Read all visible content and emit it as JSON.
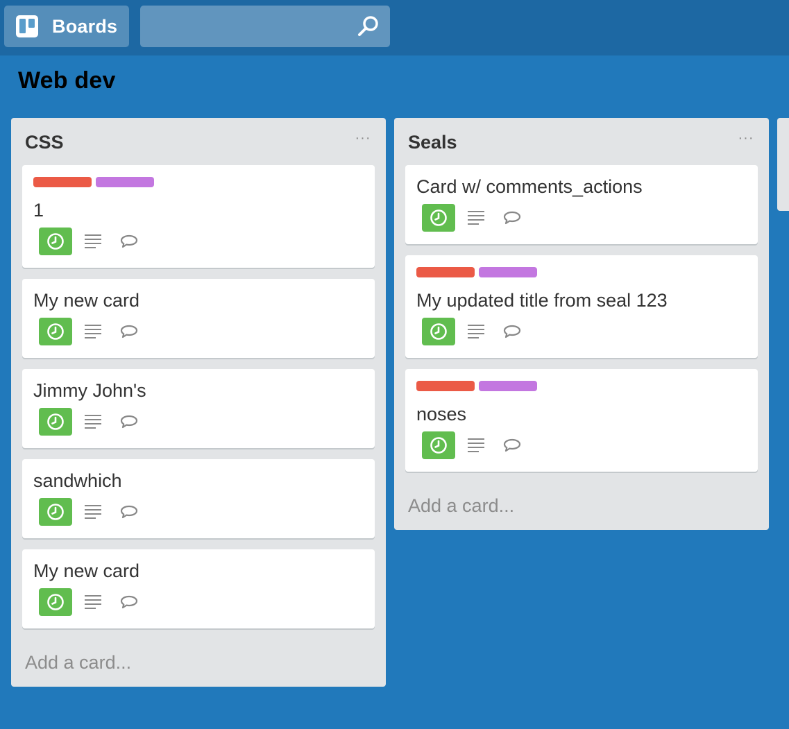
{
  "header": {
    "boards_label": "Boards",
    "boards_icon": "boards-icon",
    "search_icon": "search-icon",
    "search_value": ""
  },
  "board": {
    "title": "Web dev"
  },
  "lists": [
    {
      "name": "CSS",
      "menu_glyph": "···",
      "add_card": "Add a card...",
      "cards": [
        {
          "title": "1",
          "labels": [
            "#eb5a46",
            "#c377e0"
          ]
        },
        {
          "title": "My new card",
          "labels": []
        },
        {
          "title": "Jimmy John's",
          "labels": []
        },
        {
          "title": "sandwhich",
          "labels": []
        },
        {
          "title": "My new card",
          "labels": []
        }
      ]
    },
    {
      "name": "Seals",
      "menu_glyph": "···",
      "add_card": "Add a card...",
      "cards": [
        {
          "title": "Card w/ comments_actions",
          "labels": []
        },
        {
          "title": "My updated title from seal 123",
          "labels": [
            "#eb5a46",
            "#c377e0"
          ]
        },
        {
          "title": "noses",
          "labels": [
            "#eb5a46",
            "#c377e0"
          ]
        }
      ]
    }
  ],
  "badge_icons": {
    "due": "clock-icon",
    "description": "description-icon",
    "comments": "comment-icon"
  },
  "colors": {
    "board_background": "#2179bb",
    "topbar": "#1d68a3",
    "list_background": "#e2e4e6",
    "due_badge": "#61bd4f",
    "label_red": "#eb5a46",
    "label_purple": "#c377e0"
  }
}
